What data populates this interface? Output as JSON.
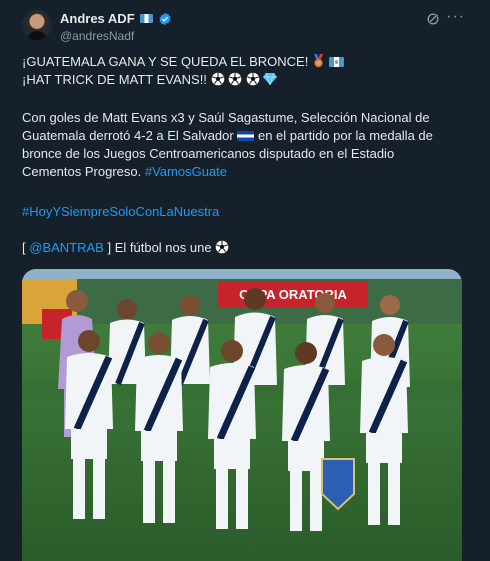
{
  "author": {
    "display_name": "Andres ADF",
    "handle": "@andresNadf"
  },
  "tweet": {
    "line1": "¡GUATEMALA GANA Y SE QUEDA EL BRONCE!",
    "line2": "¡HAT TRICK DE MATT EVANS!!",
    "p1": "Con goles de Matt Evans x3 y Saúl Sagastume, Selección Nacional de",
    "p2_a": "Guatemala derrotó 4-2 a El Salvador",
    "p2_b": "en el partido por la medalla de",
    "p3": "bronce de los Juegos Centroamericanos disputado en el Estadio",
    "p4": "Cementos Progreso.",
    "hashtag1": "#VamosGuate",
    "hashtag2": "#HoyYSiempreSoloConLaNuestra",
    "bracket_open": "[",
    "mention": "@BANTRAB",
    "bracket_close": "] El fútbol nos une",
    "ad_text": "COPA ORATORIA"
  },
  "colors": {
    "link": "#1d9bf0",
    "text": "#e7e9ea",
    "secondary": "#8b98a5",
    "background": "#15202b",
    "verified": "#1d9bf0"
  },
  "icons": [
    "verified-icon",
    "grok-icon",
    "more-icon",
    "medal-icon",
    "guatemala-flag-icon",
    "soccer-ball-icon",
    "gem-icon",
    "el-salvador-flag-icon"
  ]
}
